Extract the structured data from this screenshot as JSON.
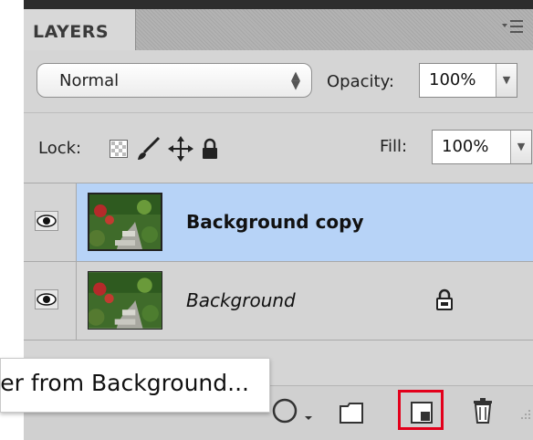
{
  "panel": {
    "tab_label": "LAYERS",
    "blend_mode": "Normal",
    "opacity_label": "Opacity:",
    "opacity_value": "100%",
    "lock_label": "Lock:",
    "fill_label": "Fill:",
    "fill_value": "100%"
  },
  "layers": [
    {
      "name": "Background copy",
      "style": "bold",
      "selected": true,
      "visible": true,
      "locked": false
    },
    {
      "name": "Background",
      "style": "italic",
      "selected": false,
      "visible": true,
      "locked": true
    }
  ],
  "tooltip": {
    "text": "New Layer from Background..."
  },
  "footer": {
    "icons": [
      "adjustment-layer-icon",
      "new-group-icon",
      "new-layer-icon",
      "trash-icon",
      "resize-grip-icon"
    ],
    "highlighted": "new-layer-icon"
  },
  "colors": {
    "selection": "#b7d3f7",
    "highlight": "#e3001b",
    "panel": "#d5d5d5"
  }
}
